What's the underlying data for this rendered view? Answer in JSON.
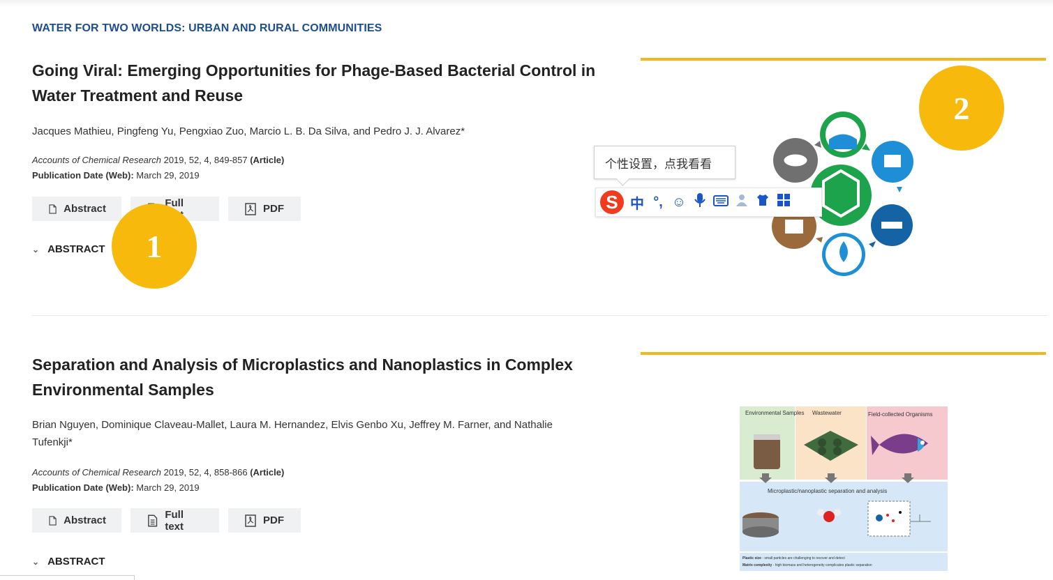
{
  "section_heading": "WATER FOR TWO WORLDS: URBAN AND RURAL COMMUNITIES",
  "articles": [
    {
      "title": "Going Viral: Emerging Opportunities for Phage-Based Bacterial Control in Water Treatment and Reuse",
      "authors": "Jacques Mathieu, Pingfeng Yu, Pengxiao Zuo, Marcio L. B. Da Silva, and Pedro J. J. Alvarez*",
      "journal": "Accounts of Chemical Research",
      "citation": " 2019, 52, 4, 849-857 ",
      "type": "(Article)",
      "pubdate_label": "Publication Date (Web):",
      "pubdate": " March 29, 2019",
      "buttons": {
        "abstract": "Abstract",
        "fulltext": "Full text",
        "pdf": "PDF"
      },
      "abstract_toggle": "ABSTRACT"
    },
    {
      "title": "Separation and Analysis of Microplastics and Nanoplastics in Complex Environmental Samples",
      "authors": "Brian Nguyen, Dominique Claveau-Mallet, Laura M. Hernandez, Elvis Genbo Xu, Jeffrey M. Farner, and Nathalie Tufenkji*",
      "journal": "Accounts of Chemical Research",
      "citation": " 2019, 52, 4, 858-866 ",
      "type": "(Article)",
      "pubdate_label": "Publication Date (Web):",
      "pubdate": " March 29, 2019",
      "buttons": {
        "abstract": "Abstract",
        "fulltext": "Full text",
        "pdf": "PDF"
      },
      "abstract_toggle": "ABSTRACT",
      "graphic": {
        "col1": "Environmental Samples",
        "col2": "Wastewater",
        "col3": "Field-collected Organisms",
        "process": "Microplastic/nanoplastic separation and analysis",
        "note1_bold": "Plastic size",
        "note1": " - small particles are challenging to recover and detect",
        "note2_bold": "Matrix complexity",
        "note2": " - high biomass and heterogeneity complicates plastic separation"
      }
    }
  ],
  "badges": [
    "1",
    "2"
  ],
  "ime": {
    "tooltip": "个性设置，点我看看",
    "logo": "S",
    "tools": [
      "中",
      "°,",
      "☺",
      "🎤",
      "⌨",
      "👤",
      "👕",
      "⊞"
    ]
  },
  "colors": {
    "accent_gold": "#f2b81b",
    "badge": "#f6b90c",
    "link_blue": "#1f4e8c"
  }
}
